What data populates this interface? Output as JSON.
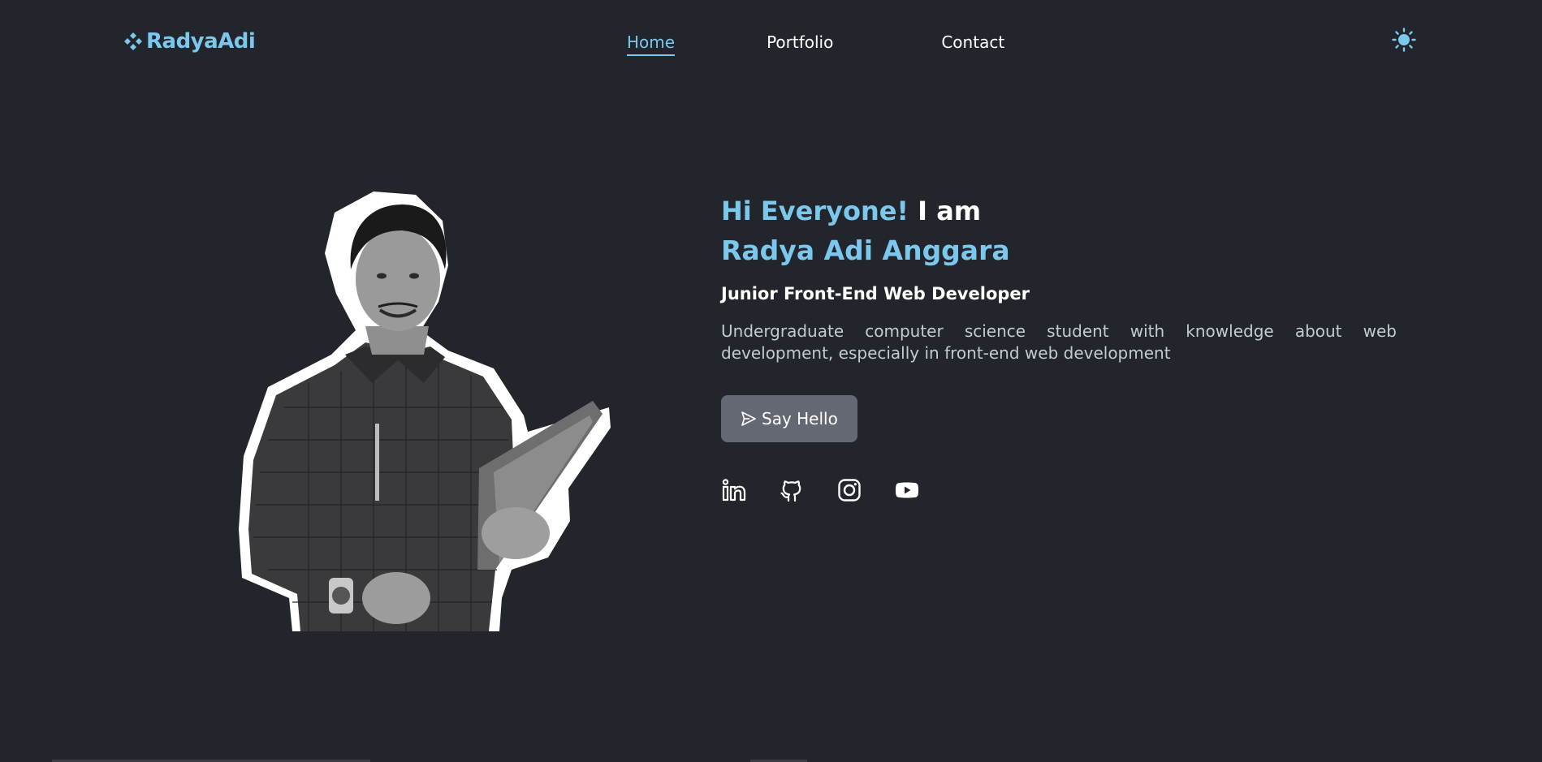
{
  "header": {
    "logo_text": "RadyaAdi",
    "nav": [
      {
        "label": "Home",
        "active": true
      },
      {
        "label": "Portfolio",
        "active": false
      },
      {
        "label": "Contact",
        "active": false
      }
    ],
    "theme_icon": "sun-icon"
  },
  "hero": {
    "greeting_accent": "Hi Everyone!",
    "greeting_rest": " I am",
    "name": "Radya Adi Anggara",
    "role": "Junior Front-End Web Developer",
    "description": "Undergraduate computer science student with knowledge about web development, especially in front-end web development",
    "cta_label": "Say Hello",
    "cta_icon": "send-icon",
    "socials": [
      "linkedin-icon",
      "github-icon",
      "instagram-icon",
      "youtube-icon"
    ]
  },
  "colors": {
    "background": "#22252b",
    "accent": "#7cc8ec",
    "button": "#646873",
    "text": "#ffffff",
    "muted_text": "#c5c9d1"
  }
}
